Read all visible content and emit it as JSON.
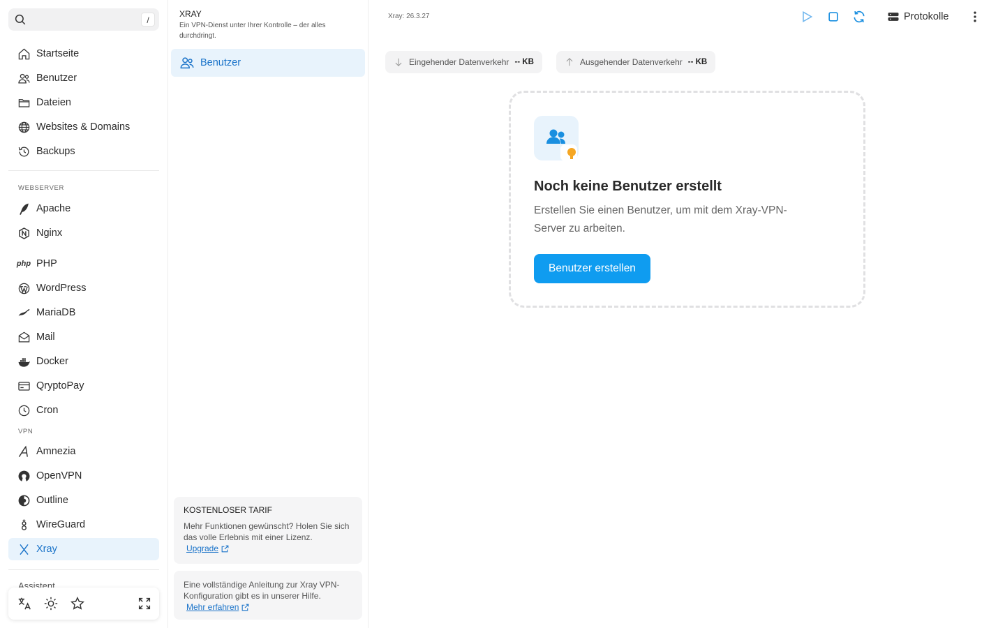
{
  "search": {
    "shortcut": "/"
  },
  "sidebar": {
    "items": [
      {
        "label": "Startseite"
      },
      {
        "label": "Benutzer"
      },
      {
        "label": "Dateien"
      },
      {
        "label": "Websites & Domains"
      },
      {
        "label": "Backups"
      }
    ],
    "section_webserver": "WEBSERVER",
    "webserver_items": [
      {
        "label": "Apache"
      },
      {
        "label": "Nginx"
      },
      {
        "label": "PHP"
      },
      {
        "label": "WordPress"
      },
      {
        "label": "MariaDB"
      },
      {
        "label": "Mail"
      },
      {
        "label": "Docker"
      },
      {
        "label": "QryptoPay"
      },
      {
        "label": "Cron"
      }
    ],
    "section_vpn": "VPN",
    "vpn_items": [
      {
        "label": "Amnezia"
      },
      {
        "label": "OpenVPN"
      },
      {
        "label": "Outline"
      },
      {
        "label": "WireGuard"
      },
      {
        "label": "Xray"
      }
    ],
    "peek_label": "Assistent",
    "php_logo_text": "php"
  },
  "panel": {
    "title": "XRAY",
    "subtitle": "Ein VPN-Dienst unter Ihrer Kontrolle – der alles durchdringt.",
    "item": "Benutzer",
    "plan_card": {
      "title": "KOSTENLOSER TARIF",
      "body": "Mehr Funktionen gewünscht? Holen Sie sich das volle Erlebnis mit einer Lizenz.",
      "link": "Upgrade"
    },
    "help_card": {
      "body": "Eine vollständige Anleitung zur Xray VPN-Konfiguration gibt es in unserer Hilfe.",
      "link": "Mehr erfahren"
    }
  },
  "main": {
    "version": "Xray: 26.3.27",
    "logs_label": "Protokolle",
    "incoming": {
      "label": "Eingehender Datenverkehr",
      "value": "-- KB"
    },
    "outgoing": {
      "label": "Ausgehender Datenverkehr",
      "value": "-- KB"
    },
    "empty": {
      "title": "Noch keine Benutzer erstellt",
      "text": "Erstellen Sie einen Benutzer, um mit dem Xray-VPN-Server zu arbeiten.",
      "button": "Benutzer erstellen"
    }
  },
  "colors": {
    "accent": "#1a73c9",
    "primary_button": "#0f9cf0",
    "active_bg": "#e8f3fc",
    "warning": "#f5a623"
  }
}
